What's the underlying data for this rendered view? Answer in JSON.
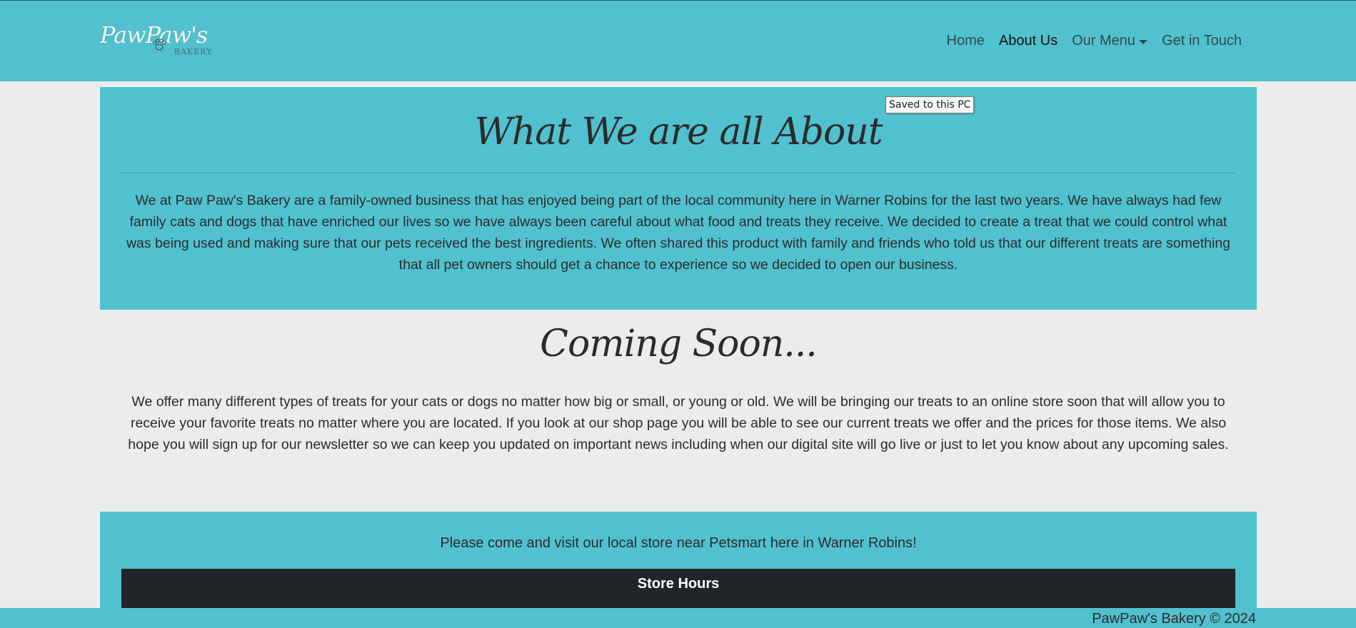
{
  "brand": {
    "logo_script": "PawPaw's",
    "logo_sub": "BAKERY"
  },
  "nav": {
    "items": [
      {
        "label": "Home"
      },
      {
        "label": "About Us"
      },
      {
        "label": "Our Menu"
      },
      {
        "label": "Get in Touch"
      }
    ],
    "active": "About Us"
  },
  "tooltip": "Saved to this PC",
  "about": {
    "heading": "What We are all About",
    "body": "We at Paw Paw's Bakery are a family-owned business that has enjoyed being part of the local community here in Warner Robins for the last two years. We have always had few family cats and dogs that have enriched our lives so we have always been careful about what food and treats they receive. We decided to create a treat that we could control what was being used and making sure that our pets received the best ingredients. We often shared this product with family and friends who told us that our different treats are something that all pet owners should get a chance to experience so we decided to open our business."
  },
  "coming_soon": {
    "heading": "Coming Soon...",
    "body": "We offer many different types of treats for your cats or dogs no matter how big or small, or young or old. We will be bringing our treats to an online store soon that will allow you to receive your favorite treats no matter where you are located. If you look at our shop page you will be able to see our current treats we offer and the prices for those items. We also hope you will sign up for our newsletter so we can keep you updated on important news including when our digital site will go live or just to let you know about any upcoming sales."
  },
  "visit": {
    "line": "Please come and visit our local store near Petsmart here in Warner Robins!",
    "hours_title": "Store Hours"
  },
  "footer": {
    "text": "PawPaw's Bakery © 2024"
  },
  "colors": {
    "teal": "#52c1cf",
    "page_bg": "#ececec",
    "dark_bar": "#212529",
    "text": "#2b2b2b"
  },
  "icons": [
    "paw-icon",
    "chevron-down-icon"
  ]
}
